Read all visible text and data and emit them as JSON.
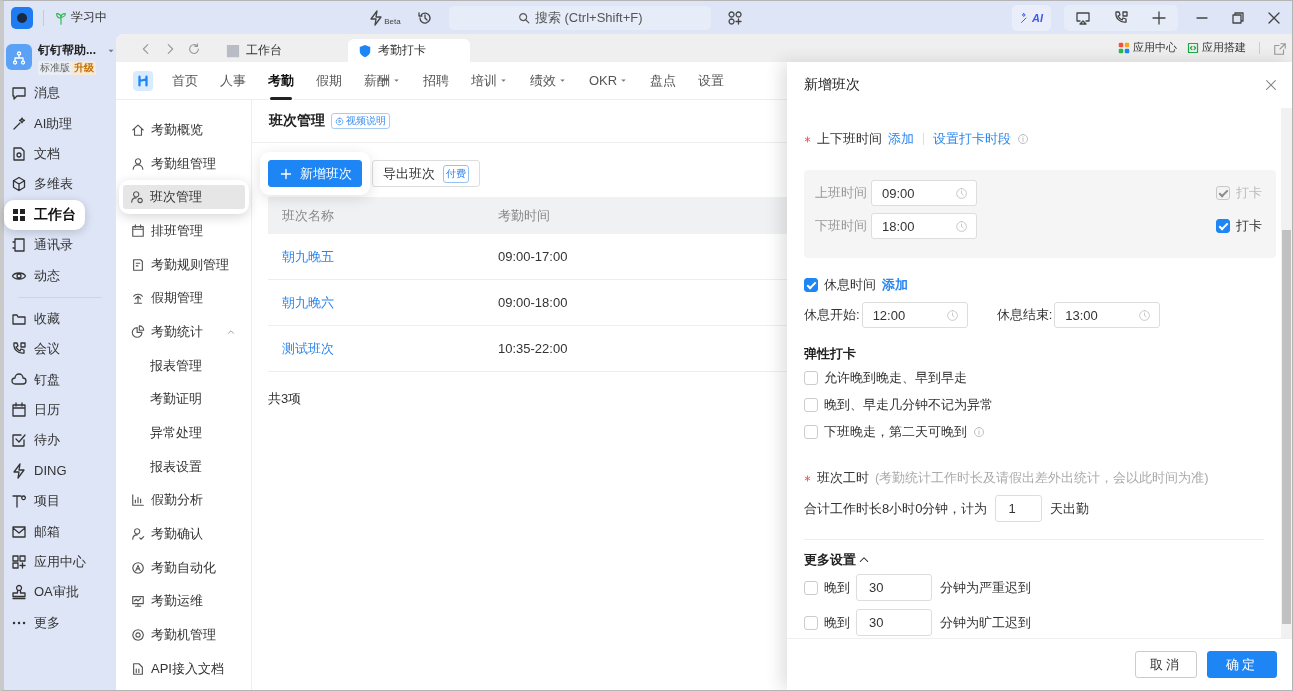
{
  "titlebar": {
    "status": "学习中",
    "beta_label": "Beta",
    "search_placeholder": "搜索 (Ctrl+Shift+F)",
    "ai_label": "AI"
  },
  "rail": {
    "org": {
      "name": "钉钉帮助...",
      "plan": "标准版",
      "upgrade": "升级"
    },
    "groups": [
      {
        "items": [
          {
            "label": "消息",
            "selected": false,
            "spotlight": false
          },
          {
            "label": "AI助理",
            "selected": false,
            "spotlight": false
          },
          {
            "label": "文档",
            "selected": false,
            "spotlight": false
          },
          {
            "label": "多维表",
            "selected": false,
            "spotlight": false
          },
          {
            "label": "工作台",
            "selected": true,
            "spotlight": true
          },
          {
            "label": "通讯录",
            "selected": false,
            "spotlight": false
          },
          {
            "label": "动态",
            "selected": false,
            "spotlight": false
          }
        ]
      },
      {
        "items": [
          {
            "label": "收藏",
            "selected": false,
            "spotlight": false
          },
          {
            "label": "会议",
            "selected": false,
            "spotlight": false
          },
          {
            "label": "钉盘",
            "selected": false,
            "spotlight": false
          },
          {
            "label": "日历",
            "selected": false,
            "spotlight": false
          },
          {
            "label": "待办",
            "selected": false,
            "spotlight": false
          },
          {
            "label": "DING",
            "selected": false,
            "spotlight": false
          },
          {
            "label": "项目",
            "selected": false,
            "spotlight": false
          },
          {
            "label": "邮箱",
            "selected": false,
            "spotlight": false
          },
          {
            "label": "应用中心",
            "selected": false,
            "spotlight": false
          },
          {
            "label": "OA审批",
            "selected": false,
            "spotlight": false
          },
          {
            "label": "更多",
            "selected": false,
            "spotlight": false
          }
        ]
      }
    ]
  },
  "browser": {
    "tabs": [
      {
        "label": "工作台",
        "selected": false
      },
      {
        "label": "考勤打卡",
        "selected": true
      }
    ],
    "links": [
      "应用中心",
      "应用搭建"
    ]
  },
  "app_nav": {
    "items": [
      {
        "label": "首页",
        "selected": false,
        "dropdown": false
      },
      {
        "label": "人事",
        "selected": false,
        "dropdown": false
      },
      {
        "label": "考勤",
        "selected": true,
        "dropdown": false
      },
      {
        "label": "假期",
        "selected": false,
        "dropdown": false
      },
      {
        "label": "薪酬",
        "selected": false,
        "dropdown": true
      },
      {
        "label": "招聘",
        "selected": false,
        "dropdown": false
      },
      {
        "label": "培训",
        "selected": false,
        "dropdown": true
      },
      {
        "label": "绩效",
        "selected": false,
        "dropdown": true
      },
      {
        "label": "OKR",
        "selected": false,
        "dropdown": true
      },
      {
        "label": "盘点",
        "selected": false,
        "dropdown": false
      },
      {
        "label": "设置",
        "selected": false,
        "dropdown": false
      }
    ]
  },
  "sub_nav": {
    "items": [
      {
        "label": "考勤概览",
        "selected": false,
        "spotlight": false
      },
      {
        "label": "考勤组管理",
        "selected": false,
        "spotlight": false
      },
      {
        "label": "班次管理",
        "selected": true,
        "spotlight": true
      },
      {
        "label": "排班管理",
        "selected": false,
        "spotlight": false
      },
      {
        "label": "考勤规则管理",
        "selected": false,
        "spotlight": false
      },
      {
        "label": "假期管理",
        "selected": false,
        "spotlight": false
      },
      {
        "label": "考勤统计",
        "selected": false,
        "spotlight": false,
        "expanded": true,
        "children": [
          {
            "label": "报表管理",
            "selected": false,
            "spotlight": false
          },
          {
            "label": "考勤证明",
            "selected": false,
            "spotlight": false
          },
          {
            "label": "异常处理",
            "selected": false,
            "spotlight": false
          },
          {
            "label": "报表设置",
            "selected": false,
            "spotlight": false
          }
        ]
      },
      {
        "label": "假勤分析",
        "selected": false,
        "spotlight": false
      },
      {
        "label": "考勤确认",
        "selected": false,
        "spotlight": false
      },
      {
        "label": "考勤自动化",
        "selected": false,
        "spotlight": false
      },
      {
        "label": "考勤运维",
        "selected": false,
        "spotlight": false
      },
      {
        "label": "考勤机管理",
        "selected": false,
        "spotlight": false
      },
      {
        "label": "API接入文档",
        "selected": false,
        "spotlight": false
      }
    ]
  },
  "main": {
    "title": "班次管理",
    "video_badge": "视频说明",
    "actions": [
      {
        "kind": "primary",
        "label": "新增班次",
        "spotlight": true
      },
      {
        "kind": "default",
        "label": "导出班次",
        "tag": "付费",
        "spotlight": false
      }
    ],
    "table": {
      "columns": [
        "班次名称",
        "考勤时间"
      ],
      "rows": [
        [
          "朝九晚五",
          "09:00-17:00"
        ],
        [
          "朝九晚六",
          "09:00-18:00"
        ],
        [
          "测试班次",
          "10:35-22:00"
        ]
      ]
    },
    "total": "共3项"
  },
  "drawer": {
    "title": "新增班次",
    "work_time": {
      "label": "上下班时间",
      "required": true,
      "links": [
        "添加",
        "设置打卡时段"
      ],
      "rows": [
        {
          "label": "上班时间",
          "value": "09:00",
          "punch_label": "打卡",
          "checked": true,
          "disabled": true
        },
        {
          "label": "下班时间",
          "value": "18:00",
          "punch_label": "打卡",
          "checked": true,
          "disabled": false
        }
      ]
    },
    "break": {
      "checked": true,
      "label": "休息时间",
      "link": "添加",
      "start_label": "休息开始:",
      "start_value": "12:00",
      "end_label": "休息结束:",
      "end_value": "13:00"
    },
    "flex": {
      "heading": "弹性打卡",
      "options": [
        {
          "label": "允许晚到晚走、早到早走",
          "checked": false,
          "info": false
        },
        {
          "label": "晚到、早走几分钟不记为异常",
          "checked": false,
          "info": false
        },
        {
          "label": "下班晚走，第二天可晚到",
          "checked": false,
          "info": true
        }
      ]
    },
    "hours": {
      "label": "班次工时",
      "required": true,
      "note": "(考勤统计工作时长及请假出差外出统计，会以此时间为准)",
      "sentence": "合计工作时长8小时0分钟，计为",
      "value": "1",
      "suffix": "天出勤"
    },
    "more": {
      "heading": "更多设置",
      "expanded": true,
      "rules": [
        {
          "checked": false,
          "prefix": "晚到",
          "value": "30",
          "suffix": "分钟为严重迟到"
        },
        {
          "checked": false,
          "prefix": "晚到",
          "value": "30",
          "suffix": "分钟为旷工迟到"
        }
      ]
    },
    "buttons": [
      {
        "kind": "default",
        "label": "取消"
      },
      {
        "kind": "primary",
        "label": "确定"
      }
    ]
  }
}
